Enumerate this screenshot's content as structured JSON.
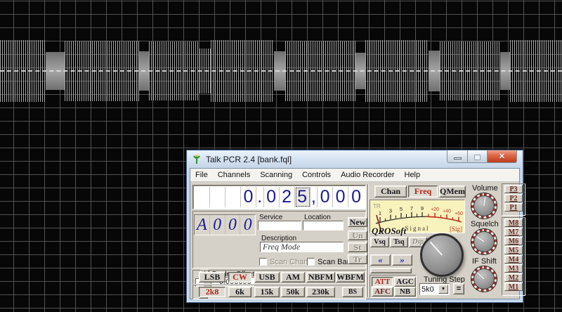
{
  "window": {
    "title": "Talk PCR 2.4 [bank.fql]",
    "controls": {
      "minimize": "minimize",
      "maximize": "maximize",
      "close": "✕"
    }
  },
  "menu": {
    "items": [
      "File",
      "Channels",
      "Scanning",
      "Controls",
      "Audio Recorder",
      "Help"
    ]
  },
  "freq": {
    "digits": [
      "",
      "",
      "",
      "0",
      ".",
      "0",
      "2",
      "5",
      ",",
      "0",
      "0",
      "0"
    ],
    "value": "0.025,000",
    "selected_digit_index": 7
  },
  "display_tabs": {
    "items": [
      "Chan",
      "Freq",
      "QMem"
    ],
    "active": "Freq"
  },
  "meter": {
    "corner": "TR",
    "ticks": [
      "1",
      "3",
      "5",
      "7",
      "9",
      "+20",
      "+40",
      "+60"
    ],
    "label": "Signal",
    "sig": "[Sig]",
    "bg_color": "#f8f2bd",
    "red_color": "#c03020"
  },
  "channel": {
    "chars": [
      "A",
      "0",
      "0",
      "0"
    ]
  },
  "fields": {
    "service_label": "Service",
    "service_value": "",
    "location_label": "Location",
    "location_value": "",
    "description_label": "Description",
    "description_value": "Freq Mode"
  },
  "actions": {
    "new": "New",
    "un": "Un",
    "st": "St",
    "tr": "Tr"
  },
  "duplex": {
    "plus": "+",
    "minus": "-",
    "label": "Duplex Offset",
    "value": "0.000000",
    "checked": false
  },
  "scan": {
    "chan_label": "Scan Chan",
    "chan_checked": false,
    "bank_label": "Scan Bank",
    "bank_checked": false
  },
  "modes": {
    "items": [
      "LSB",
      "CW",
      "USB",
      "AM",
      "NBFM",
      "WBFM"
    ],
    "active": "CW"
  },
  "filters": {
    "items": [
      "2k8",
      "6k",
      "15k",
      "50k",
      "230k",
      "BS"
    ],
    "active": "2k8"
  },
  "brand": "QROSoft",
  "squelch_buttons": {
    "vsq": "Vsq",
    "tsq": "Tsq",
    "dsp": "Dsp"
  },
  "arrows": {
    "left": "«",
    "right": "»"
  },
  "toggles": {
    "att": "ATT",
    "agc": "AGC",
    "afc": "AFC",
    "nb": "NB",
    "active": "ATT"
  },
  "tuning": {
    "label": "Tuning Step",
    "step": "5k0",
    "equals": "="
  },
  "knobs": {
    "volume": "Volume",
    "squelch": "Squelch",
    "ifshift": "IF Shift"
  },
  "presets": {
    "items": [
      "P3",
      "P2",
      "P1"
    ]
  },
  "memories": {
    "items": [
      "M8",
      "M7",
      "M6",
      "M5",
      "M4",
      "M3",
      "M2",
      "M1"
    ]
  },
  "colors": {
    "accent_red": "#b22418",
    "digit_blue": "#1b1b8e",
    "client_gray": "#d5d1c8"
  }
}
